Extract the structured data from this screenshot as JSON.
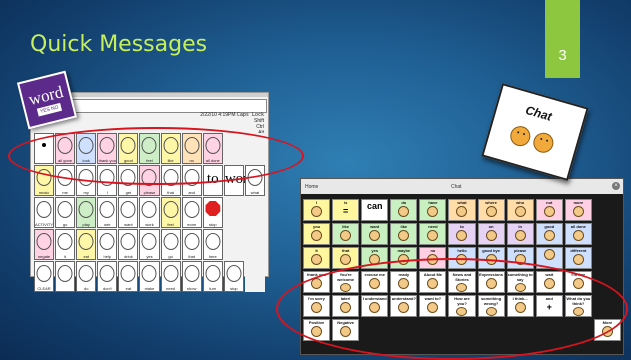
{
  "slide": {
    "title": "Quick Messages",
    "number": "3"
  },
  "word_logo": {
    "word": "word",
    "yes_no": "YES NO"
  },
  "left_app": {
    "status_time": "2/22/10 4:19PM",
    "caps_lock": "Caps Lock",
    "shift": "Shift",
    "ctrl": "Ctrl",
    "alt": "Alt",
    "rows": [
      [
        {
          "label": "",
          "color": "",
          "kind": "dot"
        },
        {
          "label": "all gone",
          "color": "p"
        },
        {
          "label": "look",
          "color": "b"
        },
        {
          "label": "thank you",
          "color": "p"
        },
        {
          "label": "good",
          "color": "y"
        },
        {
          "label": "feel",
          "color": "g"
        },
        {
          "label": "like",
          "color": "y"
        },
        {
          "label": "no",
          "color": "o"
        },
        {
          "label": "all done",
          "color": "p"
        },
        {
          "label": "",
          "color": "k"
        },
        {
          "label": "",
          "color": "k"
        }
      ],
      [
        {
          "label": "music",
          "color": "y"
        },
        {
          "label": "me",
          "color": ""
        },
        {
          "label": "my",
          "color": ""
        },
        {
          "label": "I",
          "color": ""
        },
        {
          "label": "get",
          "color": ""
        },
        {
          "label": "please",
          "color": "p"
        },
        {
          "label": "that",
          "color": ""
        },
        {
          "label": "and",
          "color": ""
        },
        {
          "label": "",
          "color": "",
          "kind": "big",
          "big": "to"
        },
        {
          "label": "",
          "color": "",
          "kind": "big",
          "big": "word"
        },
        {
          "label": "what",
          "color": ""
        }
      ],
      [
        {
          "label": "ACTIVITY",
          "color": ""
        },
        {
          "label": "go",
          "color": ""
        },
        {
          "label": "play",
          "color": "g"
        },
        {
          "label": "see",
          "color": ""
        },
        {
          "label": "want",
          "color": ""
        },
        {
          "label": "work",
          "color": ""
        },
        {
          "label": "feel",
          "color": "y"
        },
        {
          "label": "more",
          "color": ""
        },
        {
          "label": "stop",
          "color": "",
          "kind": "stop"
        },
        {
          "label": "",
          "color": "k"
        },
        {
          "label": "",
          "color": "k"
        }
      ],
      [
        {
          "label": "negate",
          "color": "p"
        },
        {
          "label": "it",
          "color": ""
        },
        {
          "label": "eat",
          "color": "y"
        },
        {
          "label": "help",
          "color": ""
        },
        {
          "label": "drink",
          "color": ""
        },
        {
          "label": "yes",
          "color": ""
        },
        {
          "label": "go",
          "color": ""
        },
        {
          "label": "that",
          "color": ""
        },
        {
          "label": "here",
          "color": ""
        },
        {
          "label": "",
          "color": "k"
        },
        {
          "label": "",
          "color": "k"
        }
      ],
      [
        {
          "label": "CLEAR",
          "color": ""
        },
        {
          "label": "",
          "color": ""
        },
        {
          "label": "do",
          "color": ""
        },
        {
          "label": "don't",
          "color": ""
        },
        {
          "label": "eat",
          "color": ""
        },
        {
          "label": "make",
          "color": ""
        },
        {
          "label": "need",
          "color": ""
        },
        {
          "label": "show",
          "color": ""
        },
        {
          "label": "turn",
          "color": ""
        },
        {
          "label": "stop",
          "color": ""
        },
        {
          "label": "",
          "color": "k"
        }
      ]
    ]
  },
  "chat_logo": {
    "label": "Chat"
  },
  "right_app": {
    "home": "Home",
    "title": "Chat",
    "rows": [
      [
        {
          "label": "I",
          "color": "y"
        },
        {
          "label": "is",
          "color": "y",
          "txt": "="
        },
        {
          "label": "",
          "color": "",
          "txt": "can"
        },
        {
          "label": "do",
          "color": "g"
        },
        {
          "label": "have",
          "color": "g"
        },
        {
          "label": "what",
          "color": "o"
        },
        {
          "label": "where",
          "color": "o"
        },
        {
          "label": "who",
          "color": "o"
        },
        {
          "label": "not",
          "color": "p"
        },
        {
          "label": "more",
          "color": "p"
        },
        {
          "label": "",
          "color": "k"
        }
      ],
      [
        {
          "label": "you",
          "color": "y"
        },
        {
          "label": "like",
          "color": "g"
        },
        {
          "label": "want",
          "color": "g"
        },
        {
          "label": "like",
          "color": "g"
        },
        {
          "label": "need",
          "color": "g"
        },
        {
          "label": "to",
          "color": "v"
        },
        {
          "label": "on",
          "color": "v"
        },
        {
          "label": "in",
          "color": "v"
        },
        {
          "label": "good",
          "color": "b"
        },
        {
          "label": "all done",
          "color": "b"
        },
        {
          "label": "",
          "color": "k"
        }
      ],
      [
        {
          "label": "it",
          "color": "y"
        },
        {
          "label": "that",
          "color": "y"
        },
        {
          "label": "yes",
          "color": "g"
        },
        {
          "label": "maybe",
          "color": "g"
        },
        {
          "label": "no",
          "color": "p"
        },
        {
          "label": "hello",
          "color": "b"
        },
        {
          "label": "good bye",
          "color": "b"
        },
        {
          "label": "please",
          "color": "b"
        },
        {
          "label": "",
          "color": "b"
        },
        {
          "label": "different",
          "color": "b"
        },
        {
          "label": "",
          "color": "k"
        }
      ],
      [
        {
          "label": "thank you",
          "color": ""
        },
        {
          "label": "You're welcome",
          "color": ""
        },
        {
          "label": "excuse me",
          "color": ""
        },
        {
          "label": "ready",
          "color": ""
        },
        {
          "label": "About Me",
          "color": ""
        },
        {
          "label": "News and Stories",
          "color": ""
        },
        {
          "label": "Expressions",
          "color": ""
        },
        {
          "label": "something to say",
          "color": ""
        },
        {
          "label": "wait",
          "color": ""
        },
        {
          "label": "I'm fine",
          "color": ""
        },
        {
          "label": "",
          "color": "k"
        }
      ],
      [
        {
          "label": "I'm sorry",
          "color": ""
        },
        {
          "label": "later!",
          "color": ""
        },
        {
          "label": "I understand",
          "color": ""
        },
        {
          "label": "understand?",
          "color": ""
        },
        {
          "label": "want to?",
          "color": ""
        },
        {
          "label": "How are you?",
          "color": ""
        },
        {
          "label": "something wrong?",
          "color": ""
        },
        {
          "label": "I think...",
          "color": ""
        },
        {
          "label": "and",
          "color": "",
          "txt": "+"
        },
        {
          "label": "What do you think?",
          "color": ""
        },
        {
          "label": "",
          "color": "k"
        }
      ],
      [
        {
          "label": "Positive",
          "color": ""
        },
        {
          "label": "Negative",
          "color": ""
        },
        {
          "label": "",
          "color": "k"
        },
        {
          "label": "",
          "color": "k"
        },
        {
          "label": "",
          "color": "k"
        },
        {
          "label": "",
          "color": "k"
        },
        {
          "label": "",
          "color": "k"
        },
        {
          "label": "",
          "color": "k"
        },
        {
          "label": "",
          "color": "k"
        },
        {
          "label": "",
          "color": "k"
        },
        {
          "label": "More",
          "color": ""
        }
      ]
    ]
  }
}
